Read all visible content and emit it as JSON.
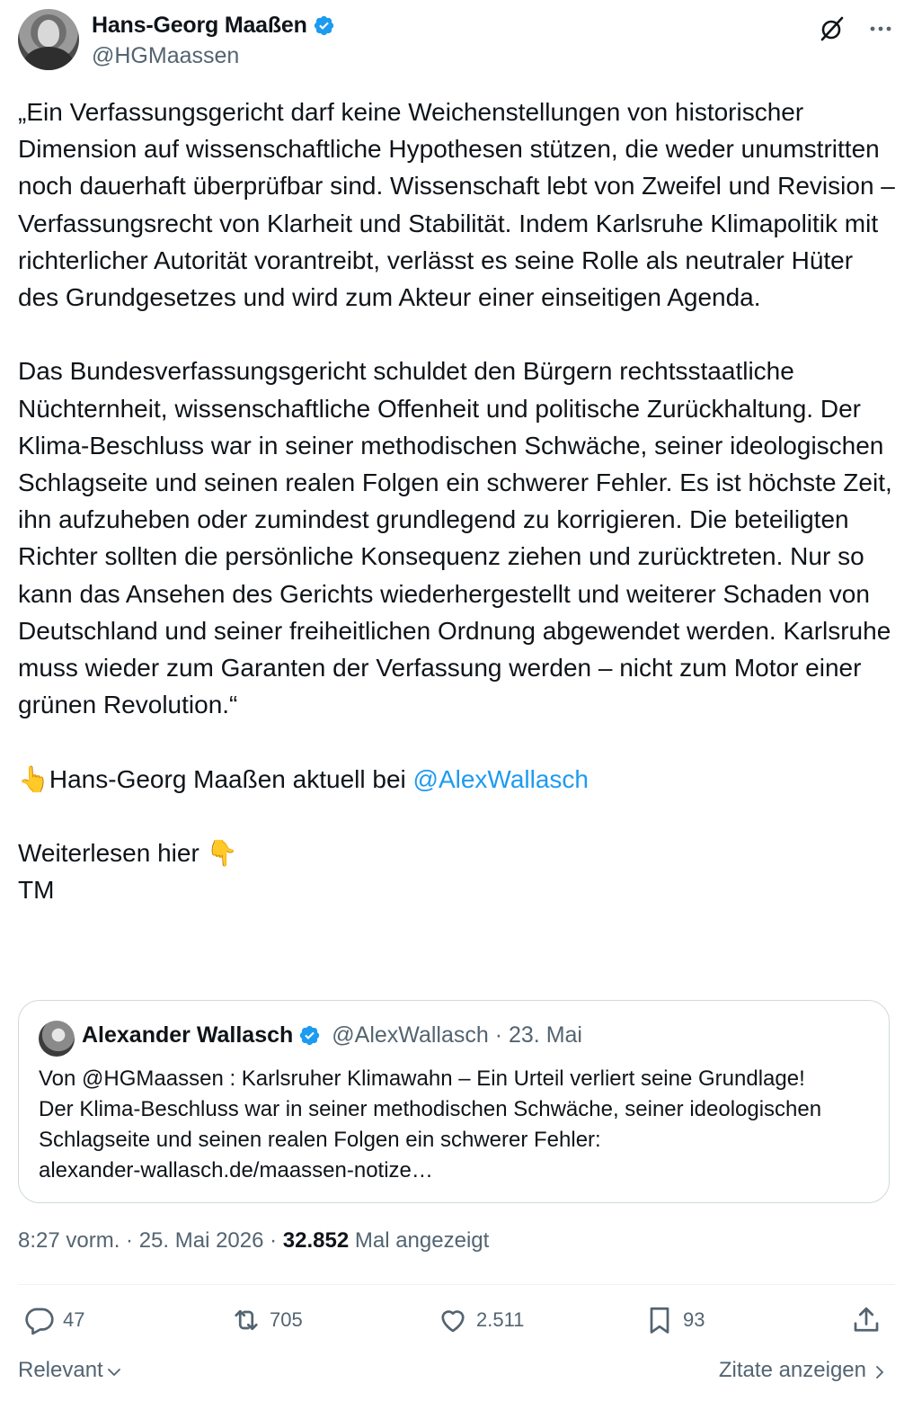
{
  "author": {
    "display_name": "Hans-Georg Maaßen",
    "handle": "@HGMaassen"
  },
  "tweet": {
    "paragraph_1": "„Ein Verfassungsgericht darf keine Weichenstellungen von historischer Dimension auf wissenschaftliche Hypothesen stützen, die weder unumstritten noch dauerhaft überprüfbar sind. Wissenschaft lebt von Zweifel und Revision – Verfassungsrecht von Klarheit und Stabilität. Indem Karlsruhe Klimapolitik mit richterlicher Autorität vorantreibt, verlässt es seine Rolle als neutraler Hüter des Grundgesetzes und wird zum Akteur einer einseitigen Agenda.",
    "paragraph_2": "Das Bundesverfassungsgericht schuldet den Bürgern rechtsstaatliche Nüchternheit, wissenschaftliche Offenheit und politische Zurückhaltung. Der Klima-Beschluss war in seiner methodischen Schwäche, seiner ideologischen Schlagseite und seinen realen Folgen ein schwerer Fehler. Es ist höchste Zeit, ihn aufzuheben oder zumindest grundlegend zu korrigieren. Die beteiligten Richter sollten die persönliche Konsequenz ziehen und zurücktreten. Nur so kann das Ansehen des Gerichts wiederhergestellt und weiterer Schaden von Deutschland und seiner freiheitlichen Ordnung abgewendet werden. Karlsruhe muss wieder zum Garanten der Verfassung werden – nicht zum Motor einer grünen Revolution.“",
    "pointer_emoji": "👆",
    "line_3_prefix": "Hans-Georg Maaßen aktuell bei ",
    "line_3_mention": "@AlexWallasch",
    "line_4": "Weiterlesen hier ",
    "down_emoji": "👇",
    "line_5": "TM"
  },
  "quote": {
    "display_name": "Alexander Wallasch",
    "handle_date": "@AlexWallasch · 23. Mai",
    "text": "Von @HGMaassen : Karlsruher Klimawahn – Ein Urteil verliert seine Grundlage!\nDer Klima-Beschluss war in seiner methodischen Schwäche, seiner ideologischen Schlagseite und seinen realen Folgen ein schwerer Fehler:\nalexander-wallasch.de/maassen-notize…"
  },
  "meta": {
    "timestamp": "8:27 vorm. · 25. Mai 2026 · ",
    "views_count": "32.852",
    "views_label": " Mal angezeigt"
  },
  "actions": {
    "replies": "47",
    "reposts": "705",
    "likes": "2.511",
    "bookmarks": "93"
  },
  "footer": {
    "sort_label": "Relevant",
    "quotes_label": "Zitate anzeigen"
  },
  "colors": {
    "accent": "#1d9bf0",
    "text": "#0f1419",
    "secondary": "#536471",
    "border": "#cfd9de"
  }
}
